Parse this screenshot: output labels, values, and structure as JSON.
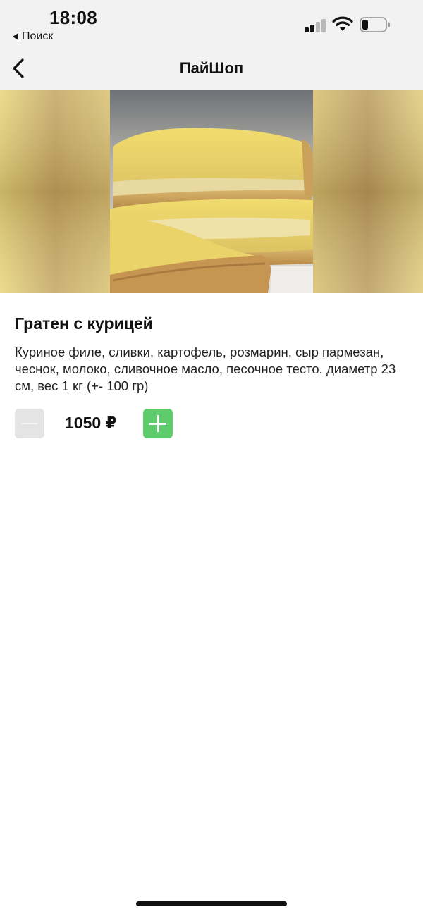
{
  "status_bar": {
    "time": "18:08",
    "back_app_label": "Поиск",
    "battery_level": 0.25
  },
  "nav": {
    "title": "ПайШоп",
    "back_icon": "chevron-left-icon"
  },
  "product": {
    "image_icon": "gratin-pie-photo",
    "title": "Гратен с курицей",
    "description": "Куриное филе, сливки, картофель, розмарин, сыр пармезан, чеснок, молоко, сливочное масло, песочное тесто. диаметр 23 см, вес 1 кг (+- 100 гр)",
    "price": "1050 ₽"
  },
  "controls": {
    "minus_icon": "minus-icon",
    "plus_icon": "plus-icon",
    "minus_enabled": false,
    "accent_color": "#5ecb6c"
  }
}
